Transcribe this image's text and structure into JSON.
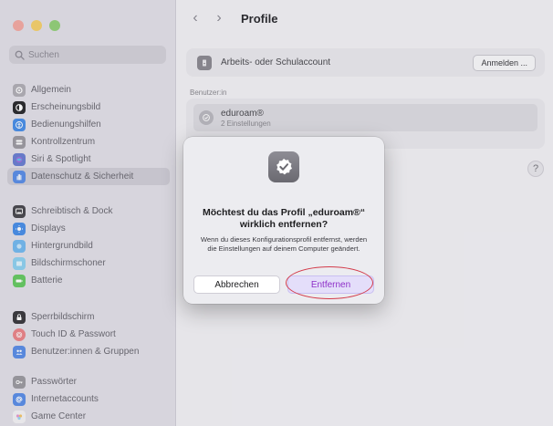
{
  "sidebar": {
    "search_placeholder": "Suchen",
    "items": [
      {
        "label": "Allgemein",
        "icon": "gear-icon",
        "color": "#b0aeb6"
      },
      {
        "label": "Erscheinungsbild",
        "icon": "appearance-icon",
        "color": "#2c2c2f"
      },
      {
        "label": "Bedienungshilfen",
        "icon": "accessibility-icon",
        "color": "#4a8fe7"
      },
      {
        "label": "Kontrollzentrum",
        "icon": "control-center-icon",
        "color": "#9c9aa2"
      },
      {
        "label": "Siri & Spotlight",
        "icon": "siri-icon",
        "color": "#6b7fd1"
      },
      {
        "label": "Datenschutz & Sicherheit",
        "icon": "hand-icon",
        "color": "#5b8ee6"
      },
      {
        "label": "Schreibtisch & Dock",
        "icon": "desktop-icon",
        "color": "#4a4950"
      },
      {
        "label": "Displays",
        "icon": "display-icon",
        "color": "#4a8fe7"
      },
      {
        "label": "Hintergrundbild",
        "icon": "wallpaper-icon",
        "color": "#74b9ef"
      },
      {
        "label": "Bildschirmschoner",
        "icon": "screensaver-icon",
        "color": "#8fd0f0"
      },
      {
        "label": "Batterie",
        "icon": "battery-icon",
        "color": "#67c964"
      },
      {
        "label": "Sperrbildschirm",
        "icon": "lock-icon",
        "color": "#3b3a40"
      },
      {
        "label": "Touch ID & Passwort",
        "icon": "fingerprint-icon",
        "color": "#e9848a"
      },
      {
        "label": "Benutzer:innen & Gruppen",
        "icon": "users-icon",
        "color": "#5b8ee6"
      },
      {
        "label": "Passwörter",
        "icon": "key-icon",
        "color": "#9b9aa1"
      },
      {
        "label": "Internetaccounts",
        "icon": "at-icon",
        "color": "#5b8ee6"
      },
      {
        "label": "Game Center",
        "icon": "game-center-icon",
        "color": "#e49ad1"
      }
    ]
  },
  "header": {
    "title": "Profile"
  },
  "work_account": {
    "label": "Arbeits- oder Schulaccount",
    "button": "Anmelden ..."
  },
  "users_group": {
    "label": "Benutzer:in",
    "profile_name": "eduroam®",
    "profile_sub": "2 Einstellungen"
  },
  "help": "?",
  "dialog": {
    "title": "Möchtest du das Profil „eduroam®“ wirklich entfernen?",
    "message": "Wenn du dieses Konfigurationsprofil entfernst, werden die Einstellungen auf deinem Computer geändert.",
    "cancel": "Abbrechen",
    "confirm": "Entfernen"
  },
  "colors": {
    "accent": "#8e2fc8",
    "highlight": "#d33b4a"
  }
}
